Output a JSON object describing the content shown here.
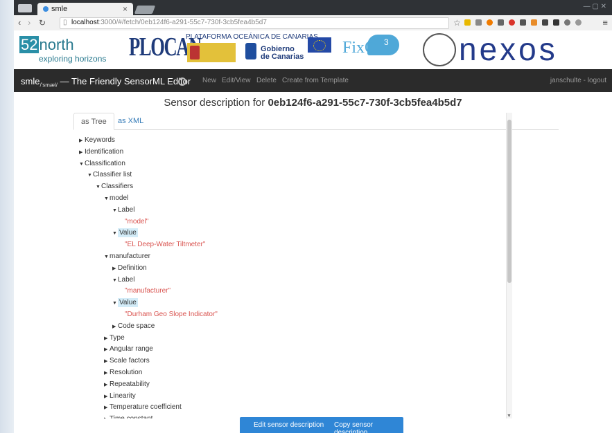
{
  "browser": {
    "tab_title": "smle",
    "url_host": "localhost",
    "url_path": ":3000/#/fetch/0eb124f6-a291-55c7-730f-3cb5fea4b5d7"
  },
  "banner": {
    "logo1_prefix": "52",
    "logo1_main": "north",
    "logo1_tagline": "exploring horizons",
    "plocan": "PLOCAN",
    "plataforma": "PLATAFORMA OCEÁNICA DE CANARIAS",
    "gobierno": "Gobierno\nde Canarias",
    "fixo": "FixO",
    "fixo_sup": "3",
    "nexos": "nexos"
  },
  "navbar": {
    "brand_main": "smle",
    "brand_sub": "/'smæl/",
    "brand_rest": " — The Friendly SensorML Editor",
    "links": [
      "New",
      "Edit/View",
      "Delete",
      "Create from Template"
    ],
    "user": "janschulte - logout"
  },
  "main": {
    "heading_prefix": "Sensor description for ",
    "heading_id": "0eb124f6-a291-55c7-730f-3cb5fea4b5d7",
    "tabs": [
      "as Tree",
      "as XML"
    ]
  },
  "tree": [
    {
      "label": "Keywords",
      "level": 0,
      "open": false
    },
    {
      "label": "Identification",
      "level": 0,
      "open": false
    },
    {
      "label": "Classification",
      "level": 0,
      "open": true
    },
    {
      "label": "Classifier list",
      "level": 1,
      "open": true
    },
    {
      "label": "Classifiers",
      "level": 2,
      "open": true
    },
    {
      "label": "model",
      "level": 3,
      "open": true
    },
    {
      "label": "Label",
      "level": 4,
      "open": true
    },
    {
      "value": "\"model\"",
      "level": 5
    },
    {
      "label": "Value",
      "level": 4,
      "open": true,
      "highlight": true
    },
    {
      "value": "\"EL Deep-Water Tiltmeter\"",
      "level": 5
    },
    {
      "label": "manufacturer",
      "level": 3,
      "open": true
    },
    {
      "label": "Definition",
      "level": 4,
      "open": false
    },
    {
      "label": "Label",
      "level": 4,
      "open": true
    },
    {
      "value": "\"manufacturer\"",
      "level": 5
    },
    {
      "label": "Value",
      "level": 4,
      "open": true,
      "highlight": true
    },
    {
      "value": "\"Durham Geo Slope Indicator\"",
      "level": 5
    },
    {
      "label": "Code space",
      "level": 4,
      "open": false
    },
    {
      "label": "Type",
      "level": 3,
      "open": false
    },
    {
      "label": "Angular range",
      "level": 3,
      "open": false
    },
    {
      "label": "Scale factors",
      "level": 3,
      "open": false
    },
    {
      "label": "Resolution",
      "level": 3,
      "open": false
    },
    {
      "label": "Repeatability",
      "level": 3,
      "open": false
    },
    {
      "label": "Linearity",
      "level": 3,
      "open": false
    },
    {
      "label": "Temperature coefficient",
      "level": 3,
      "open": false
    },
    {
      "label": "Time constant",
      "level": 3,
      "open": false
    }
  ],
  "actions": {
    "edit": "Edit sensor description",
    "copy": "Copy sensor description"
  },
  "colors": {
    "value_text": "#d9534f",
    "highlight": "#d3ecf8",
    "action_bar": "#2f86d6",
    "navbar": "#2b2b2b"
  }
}
